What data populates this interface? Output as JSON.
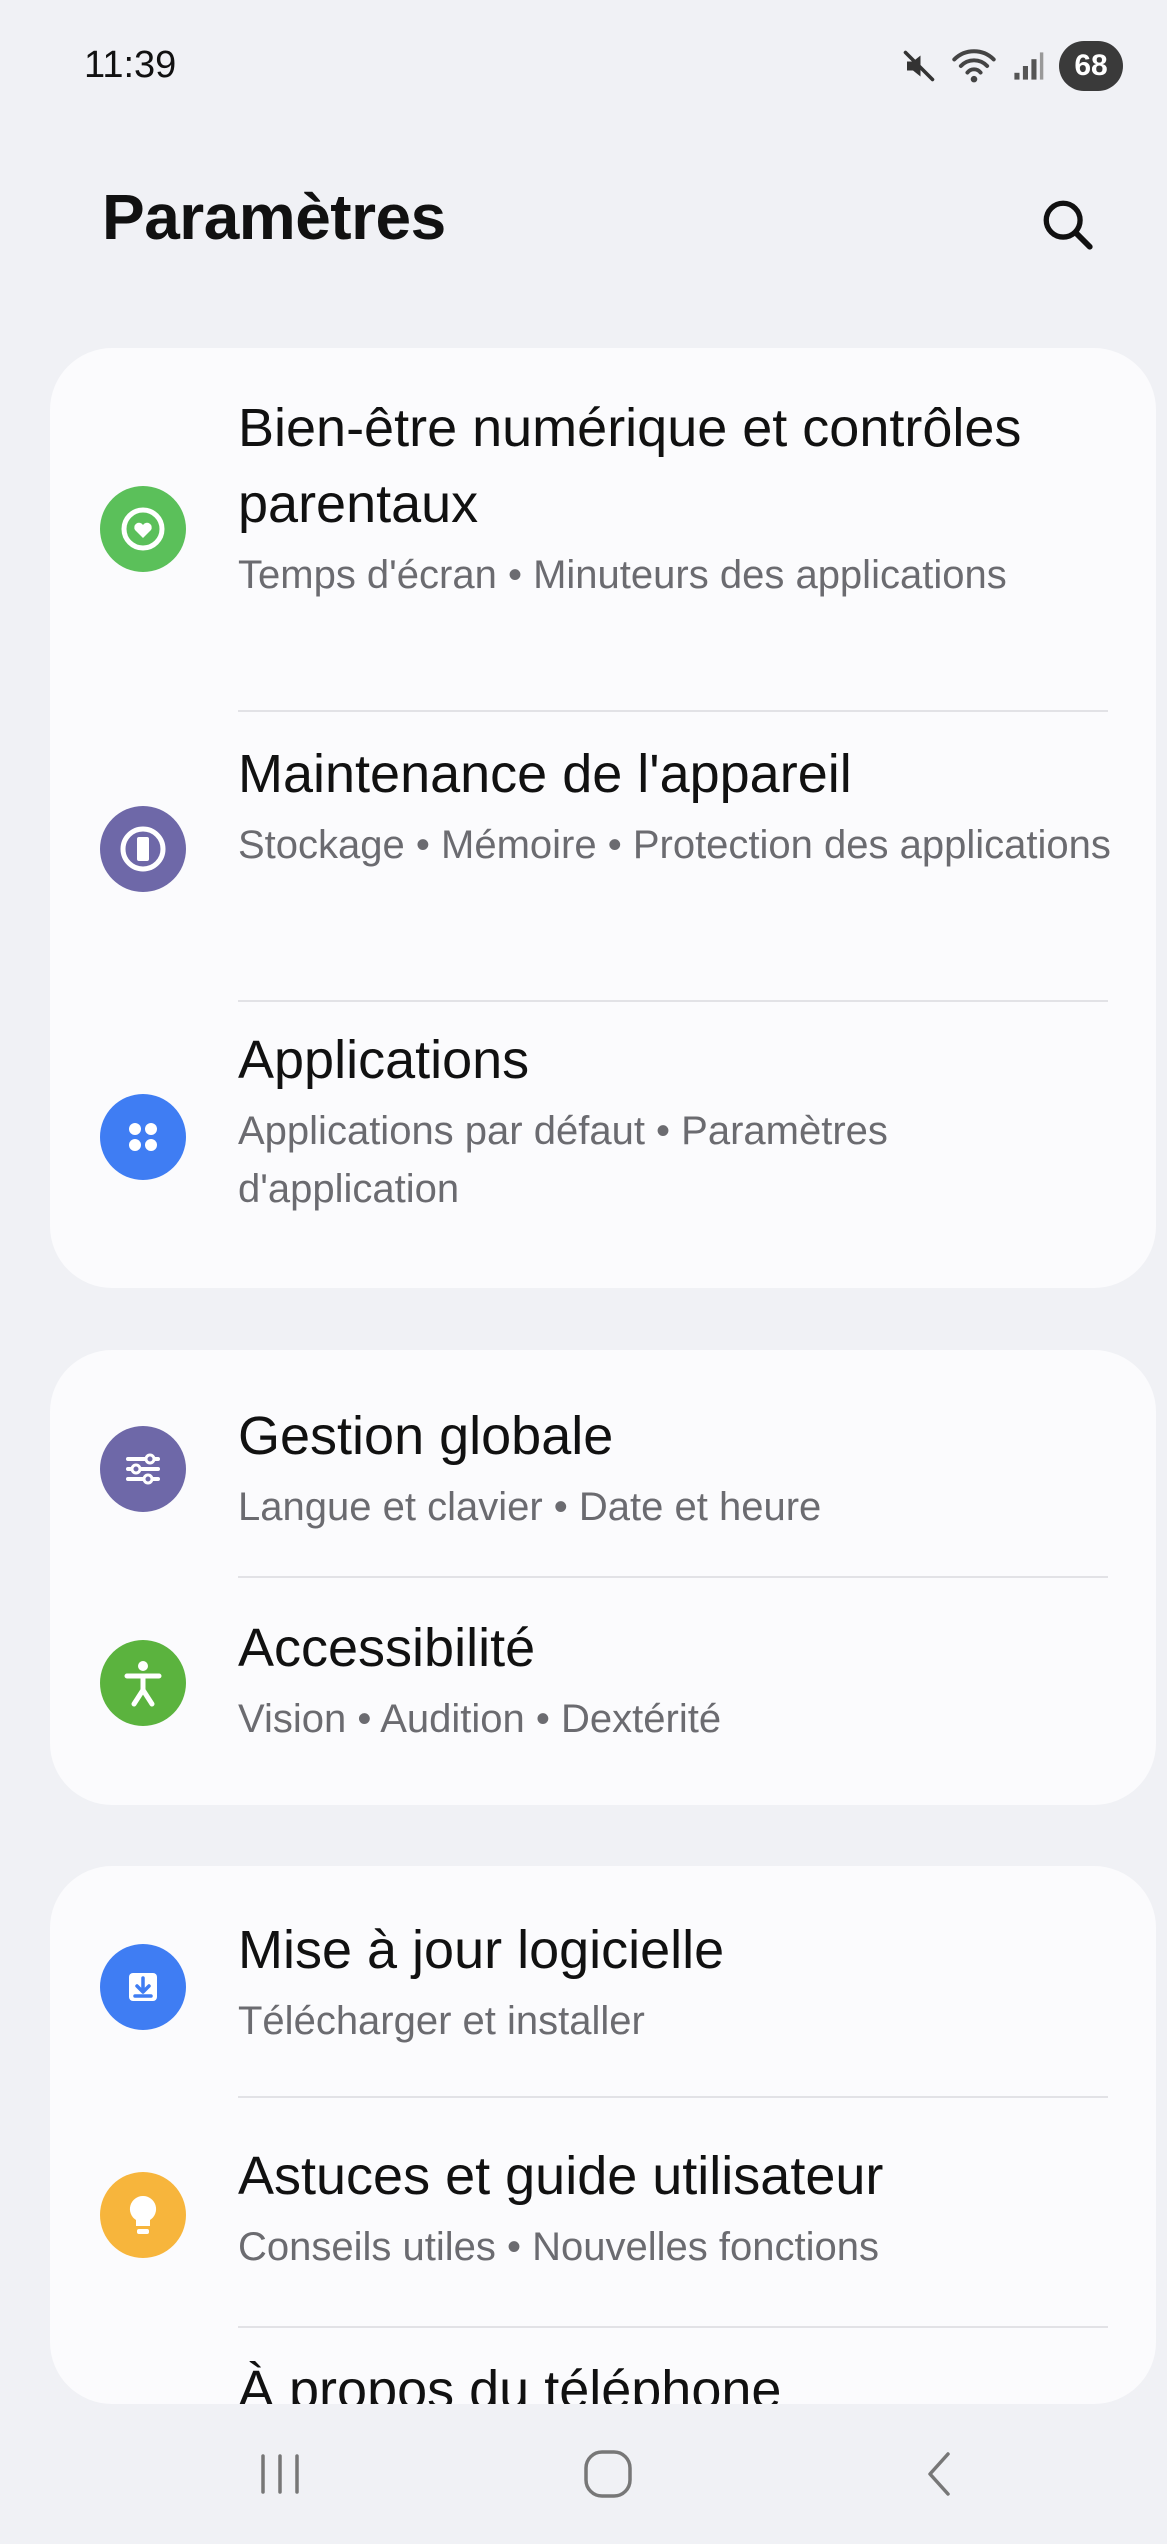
{
  "status_bar": {
    "time": "11:39",
    "battery": "68",
    "icons": [
      "mute-icon",
      "wifi-icon",
      "signal-icon",
      "battery-icon"
    ]
  },
  "header": {
    "title": "Paramètres",
    "search_icon": "search-icon"
  },
  "groups": [
    {
      "items": [
        {
          "title": "Bien-être numérique et contrôles parentaux",
          "subtitle": "Temps d'écran  •  Minuteurs des applications",
          "icon": "digital-wellbeing-icon",
          "color": "#5bc05a"
        },
        {
          "title": "Maintenance de l'appareil",
          "subtitle": "Stockage  •  Mémoire  •  Protection des applications",
          "icon": "device-care-icon",
          "color": "#6e68a8"
        },
        {
          "title": "Applications",
          "subtitle": "Applications par défaut  •  Paramètres d'application",
          "icon": "apps-icon",
          "color": "#3f7df3"
        }
      ]
    },
    {
      "items": [
        {
          "title": "Gestion globale",
          "subtitle": "Langue et clavier  •  Date et heure",
          "icon": "general-management-icon",
          "color": "#6e68a8"
        },
        {
          "title": "Accessibilité",
          "subtitle": "Vision  •  Audition  •  Dextérité",
          "icon": "accessibility-icon",
          "color": "#5bb33e"
        }
      ]
    },
    {
      "items": [
        {
          "title": "Mise à jour logicielle",
          "subtitle": "Télécharger et installer",
          "icon": "software-update-icon",
          "color": "#3f7df3"
        },
        {
          "title": "Astuces et guide utilisateur",
          "subtitle": "Conseils utiles  •  Nouvelles fonctions",
          "icon": "tips-icon",
          "color": "#f7b53c"
        },
        {
          "title": "À propos du téléphone",
          "subtitle": "",
          "icon": "",
          "color": ""
        }
      ]
    }
  ],
  "nav_bar": {
    "recents_icon": "recents-icon",
    "home_icon": "home-icon",
    "back_icon": "back-icon"
  }
}
